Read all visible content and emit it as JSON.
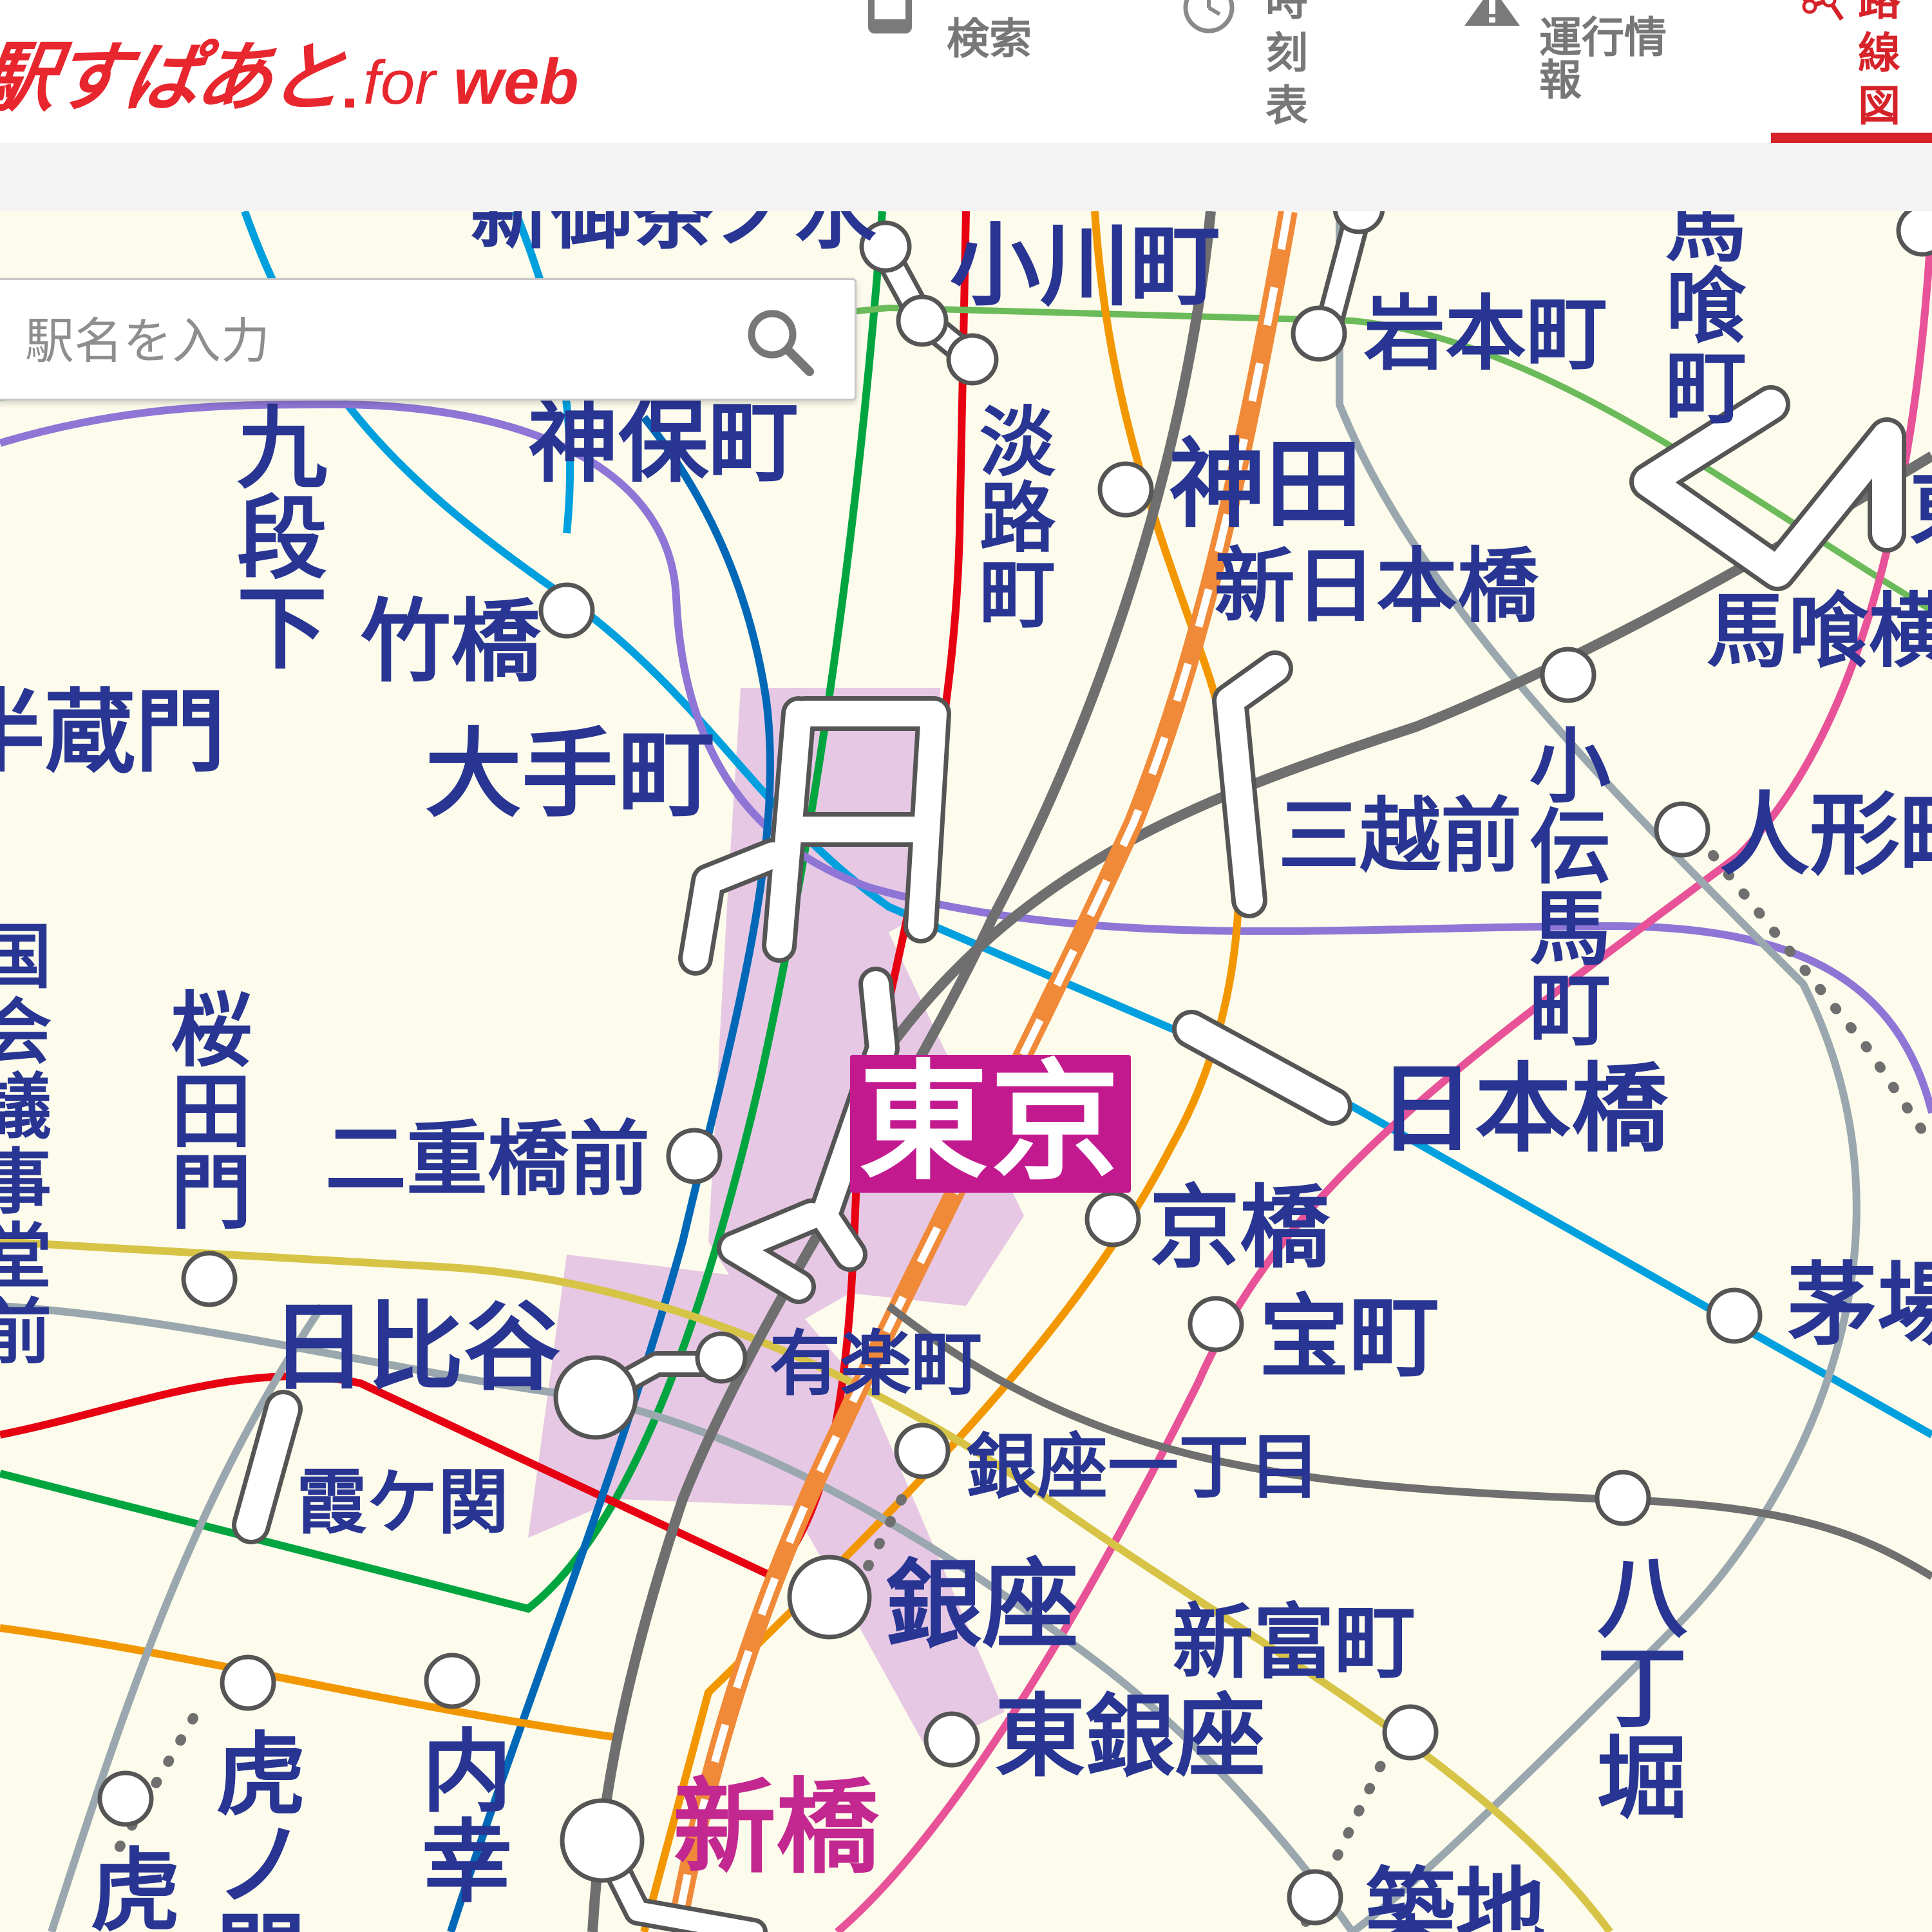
{
  "header": {
    "logo_main": "駅すぱあと",
    "logo_for": "for",
    "logo_web": "web",
    "nav": {
      "search": "検索",
      "timetable": "時刻表",
      "info": "運行情報",
      "routemap": "路線図"
    },
    "brand_color": "#e8262e",
    "active_color": "#d6232a"
  },
  "search": {
    "placeholder": "駅名を入力",
    "value": ""
  },
  "map": {
    "featured_station": "東京",
    "featured_color": "#c3198f",
    "stations": {
      "ogawamachi": "小川町",
      "iwamotocho": "岩本町",
      "bakurocho": "馬喰町",
      "jimbocho": "神保町",
      "awajicho": "淡路町",
      "kanda": "神田",
      "kudanshita": "九段下",
      "takebashi": "竹橋",
      "shin_nihombashi": "新日本橋",
      "bakuroyokoyama": "馬喰横",
      "hanzomon": "半蔵門",
      "otemachi": "大手町",
      "kodenmacho": "小伝馬町",
      "mitsukoshimae": "三越前",
      "ningyocho": "人形町",
      "kokkaigijidomae": "国会議事堂前",
      "sakuradamon": "桜田門",
      "nijubashimae": "二重橋前",
      "nihombashi": "日本橋",
      "kyobashi": "京橋",
      "takaracho": "宝町",
      "kayabacho": "茅場",
      "hibiya": "日比谷",
      "yurakucho": "有楽町",
      "ginza_itchome": "銀座一丁目",
      "kasumigaseki": "霞ケ関",
      "ginza": "銀座",
      "shintomicho": "新富町",
      "hatchobori": "八丁堀",
      "toranomon": "虎ノ門",
      "toranomon_hills": "虎",
      "uchisaiwaicho": "内幸",
      "higashi_ginza": "東銀座",
      "shimbashi": "新橋",
      "tsukiji": "築地",
      "higashi_edge": "東",
      "top_cut": "新御茶ノ水"
    },
    "line_colors": {
      "tozai": "#00a0de",
      "chiyoda": "#00a540",
      "marunouchi": "#e60012",
      "hanzomon": "#8f76d6",
      "mita": "#0068b7",
      "hibiya": "#9aa7ae",
      "ginza": "#f39700",
      "yurakucho": "#d7c447",
      "asakusa": "#e85298",
      "shinjuku": "#6cbb5a",
      "jr_chuo": "#f08a38",
      "jr_gray": "#6f6f6f"
    }
  }
}
